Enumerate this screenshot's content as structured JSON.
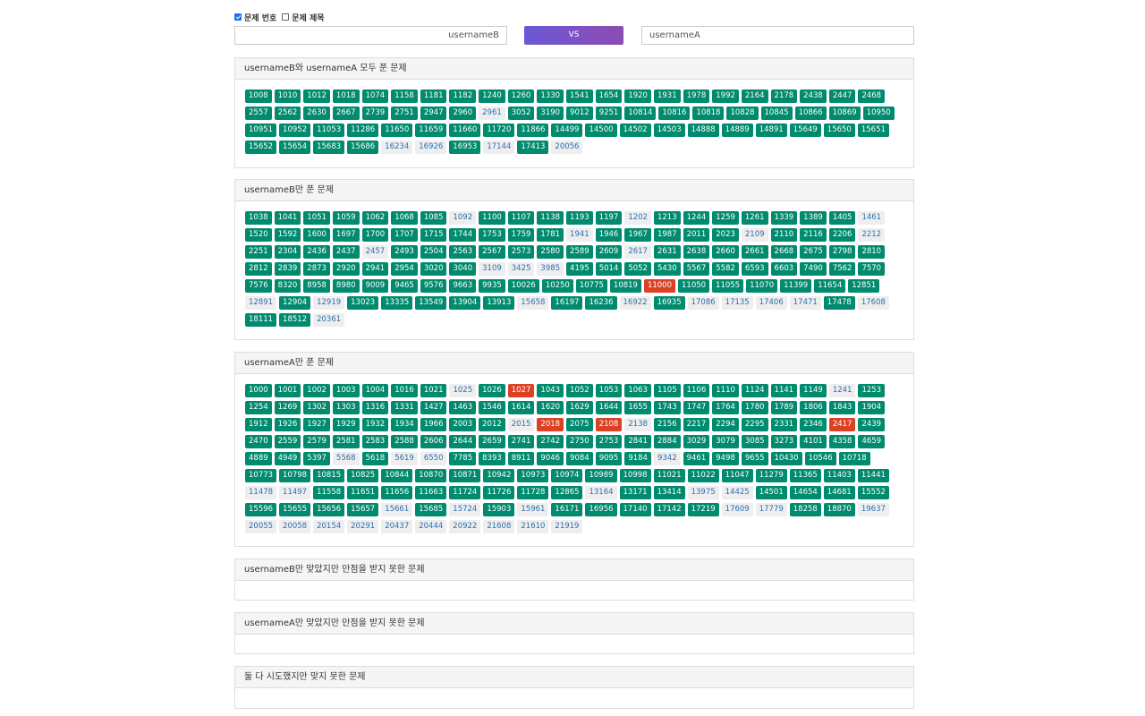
{
  "options": {
    "show_number_label": "문제 번호",
    "show_number_checked": true,
    "show_title_label": "문제 제목",
    "show_title_checked": false
  },
  "compare": {
    "left_user": "usernameB",
    "vs_label": "VS",
    "right_user": "usernameA"
  },
  "panels": [
    {
      "title": "usernameB와 usernameA 모두 푼 문제",
      "problems": [
        "1008:g",
        "1010:g",
        "1012:g",
        "1018:g",
        "1074:g",
        "1158:g",
        "1181:g",
        "1182:g",
        "1240:g",
        "1260:g",
        "1330:g",
        "1541:g",
        "1654:g",
        "1920:g",
        "1931:g",
        "1978:g",
        "1992:g",
        "2164:g",
        "2178:g",
        "2438:g",
        "2447:g",
        "2468:g",
        "2557:g",
        "2562:g",
        "2630:g",
        "2667:g",
        "2739:g",
        "2751:g",
        "2947:g",
        "2960:g",
        "2961:l",
        "3052:g",
        "3190:g",
        "9012:g",
        "9251:g",
        "10814:g",
        "10816:g",
        "10818:g",
        "10828:g",
        "10845:g",
        "10866:g",
        "10869:g",
        "10950:g",
        "10951:g",
        "10952:g",
        "11053:g",
        "11286:g",
        "11650:g",
        "11659:g",
        "11660:g",
        "11720:g",
        "11866:g",
        "14499:g",
        "14500:g",
        "14502:g",
        "14503:g",
        "14888:g",
        "14889:g",
        "14891:g",
        "15649:g",
        "15650:g",
        "15651:g",
        "15652:g",
        "15654:g",
        "15683:g",
        "15686:g",
        "16234:l",
        "16926:l",
        "16953:g",
        "17144:l",
        "17413:g",
        "20056:l"
      ]
    },
    {
      "title": "usernameB만 푼 문제",
      "problems": [
        "1038:g",
        "1041:g",
        "1051:g",
        "1059:g",
        "1062:g",
        "1068:g",
        "1085:g",
        "1092:l",
        "1100:g",
        "1107:g",
        "1138:g",
        "1193:g",
        "1197:g",
        "1202:l",
        "1213:g",
        "1244:g",
        "1259:g",
        "1261:g",
        "1339:g",
        "1389:g",
        "1405:g",
        "1461:l",
        "1520:g",
        "1592:g",
        "1600:g",
        "1697:g",
        "1700:g",
        "1707:g",
        "1715:g",
        "1744:g",
        "1753:g",
        "1759:g",
        "1781:g",
        "1941:l",
        "1946:g",
        "1967:g",
        "1987:g",
        "2011:g",
        "2023:g",
        "2109:l",
        "2110:g",
        "2116:g",
        "2206:g",
        "2212:l",
        "2251:g",
        "2304:g",
        "2436:g",
        "2437:g",
        "2457:l",
        "2493:g",
        "2504:g",
        "2563:g",
        "2567:g",
        "2573:g",
        "2580:g",
        "2589:g",
        "2609:g",
        "2617:l",
        "2631:g",
        "2638:g",
        "2660:g",
        "2661:g",
        "2668:g",
        "2675:g",
        "2798:g",
        "2810:g",
        "2812:g",
        "2839:g",
        "2873:g",
        "2920:g",
        "2941:g",
        "2954:g",
        "3020:g",
        "3040:g",
        "3109:l",
        "3425:l",
        "3985:l",
        "4195:g",
        "5014:g",
        "5052:g",
        "5430:g",
        "5567:g",
        "5582:g",
        "6593:g",
        "6603:g",
        "7490:g",
        "7562:g",
        "7570:g",
        "7576:g",
        "8320:g",
        "8958:g",
        "8980:g",
        "9009:g",
        "9465:g",
        "9576:g",
        "9663:g",
        "9935:g",
        "10026:g",
        "10250:g",
        "10775:g",
        "10819:g",
        "11000:r",
        "11050:g",
        "11055:g",
        "11070:g",
        "11399:g",
        "11654:g",
        "12851:g",
        "12891:l",
        "12904:g",
        "12919:l",
        "13023:g",
        "13335:g",
        "13549:g",
        "13904:g",
        "13913:g",
        "15658:l",
        "16197:g",
        "16236:g",
        "16922:l",
        "16935:g",
        "17086:l",
        "17135:l",
        "17406:l",
        "17471:l",
        "17478:g",
        "17608:l",
        "18111:g",
        "18512:g",
        "20361:l"
      ]
    },
    {
      "title": "usernameA만 푼 문제",
      "problems": [
        "1000:g",
        "1001:g",
        "1002:g",
        "1003:g",
        "1004:g",
        "1016:g",
        "1021:g",
        "1025:l",
        "1026:g",
        "1027:r",
        "1043:g",
        "1052:g",
        "1053:g",
        "1063:g",
        "1105:g",
        "1106:g",
        "1110:g",
        "1124:g",
        "1141:g",
        "1149:g",
        "1241:l",
        "1253:g",
        "1254:g",
        "1269:g",
        "1302:g",
        "1303:g",
        "1316:g",
        "1331:g",
        "1427:g",
        "1463:g",
        "1546:g",
        "1614:g",
        "1620:g",
        "1629:g",
        "1644:g",
        "1655:g",
        "1743:g",
        "1747:g",
        "1764:g",
        "1780:g",
        "1789:g",
        "1806:g",
        "1843:g",
        "1904:g",
        "1912:g",
        "1926:g",
        "1927:g",
        "1929:g",
        "1932:g",
        "1934:g",
        "1966:g",
        "2003:g",
        "2012:g",
        "2015:l",
        "2018:r",
        "2075:g",
        "2108:r",
        "2138:l",
        "2156:g",
        "2217:g",
        "2294:g",
        "2295:g",
        "2331:g",
        "2346:g",
        "2417:r",
        "2439:g",
        "2470:g",
        "2559:g",
        "2579:g",
        "2581:g",
        "2583:g",
        "2588:g",
        "2606:g",
        "2644:g",
        "2659:g",
        "2741:g",
        "2742:g",
        "2750:g",
        "2753:g",
        "2841:g",
        "2884:g",
        "3029:g",
        "3079:g",
        "3085:g",
        "3273:g",
        "4101:g",
        "4358:g",
        "4659:g",
        "4889:g",
        "4949:g",
        "5397:g",
        "5568:l",
        "5618:g",
        "5619:l",
        "6550:l",
        "7785:g",
        "8393:g",
        "8911:g",
        "9046:g",
        "9084:g",
        "9095:g",
        "9184:g",
        "9342:l",
        "9461:g",
        "9498:g",
        "9655:g",
        "10430:g",
        "10546:g",
        "10718:g",
        "10773:g",
        "10798:g",
        "10815:g",
        "10825:g",
        "10844:g",
        "10870:g",
        "10871:g",
        "10942:g",
        "10973:g",
        "10974:g",
        "10989:g",
        "10998:g",
        "11021:g",
        "11022:g",
        "11047:g",
        "11279:g",
        "11365:g",
        "11403:g",
        "11441:g",
        "11478:l",
        "11497:l",
        "11558:g",
        "11651:g",
        "11656:g",
        "11663:g",
        "11724:g",
        "11726:g",
        "11728:g",
        "12865:g",
        "13164:l",
        "13171:g",
        "13414:g",
        "13975:l",
        "14425:l",
        "14501:g",
        "14654:g",
        "14681:g",
        "15552:g",
        "15596:g",
        "15655:g",
        "15656:g",
        "15657:g",
        "15661:l",
        "15685:g",
        "15724:l",
        "15903:g",
        "15961:l",
        "16171:g",
        "16956:g",
        "17140:g",
        "17142:g",
        "17219:g",
        "17609:l",
        "17779:l",
        "18258:g",
        "18870:g",
        "19637:l",
        "20055:l",
        "20058:l",
        "20154:l",
        "20291:l",
        "20437:l",
        "20444:l",
        "20922:l",
        "21608:l",
        "21610:l",
        "21919:l"
      ]
    },
    {
      "title": "usernameB만 맞았지만 만점을 받지 못한 문제",
      "problems": []
    },
    {
      "title": "usernameA만 맞았지만 만점을 받지 못한 문제",
      "problems": []
    },
    {
      "title": "둘 다 시도했지만 맞지 못한 문제",
      "problems": []
    }
  ],
  "colors": {
    "solved": "#008b6e",
    "partial": "#eeeeee",
    "wrong": "#dd4124",
    "vs_gradient_start": "#6a59d6",
    "vs_gradient_end": "#8d4bb2"
  }
}
